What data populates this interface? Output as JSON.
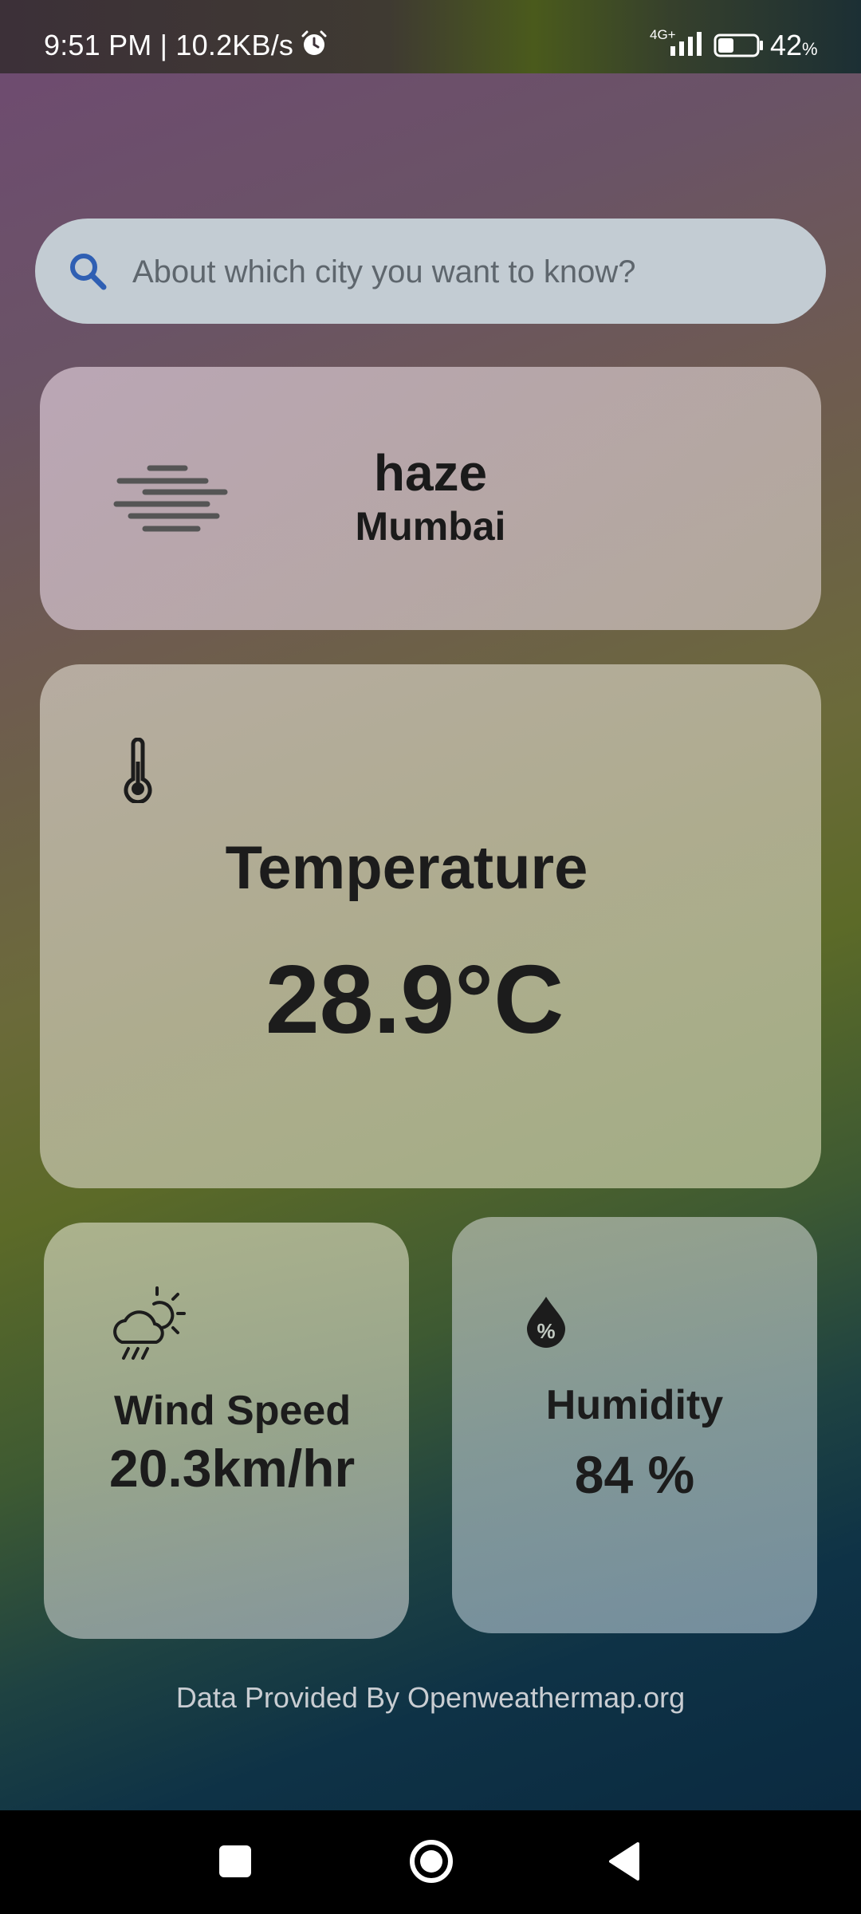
{
  "status_bar": {
    "time_speed": "9:51 PM | 10.2KB/s",
    "network": "4G+",
    "battery_percent": "42",
    "battery_symbol": "%",
    "battery_level": 0.42
  },
  "search": {
    "placeholder": "About which city you want to know?"
  },
  "condition": {
    "label": "haze",
    "city": "Mumbai",
    "icon": "haze-icon"
  },
  "temperature": {
    "title": "Temperature",
    "value": "28.9°C",
    "icon": "thermometer-icon"
  },
  "wind": {
    "title": "Wind Speed",
    "value": "20.3km/hr",
    "icon": "cloud-sun-rain-icon"
  },
  "humidity": {
    "title": "Humidity",
    "value": "84 %",
    "icon": "humidity-drop-icon"
  },
  "footer": {
    "credit": "Data Provided By Openweathermap.org"
  },
  "colors": {
    "search_icon": "#2f5fb3",
    "text_dark": "#1c1c1c"
  }
}
